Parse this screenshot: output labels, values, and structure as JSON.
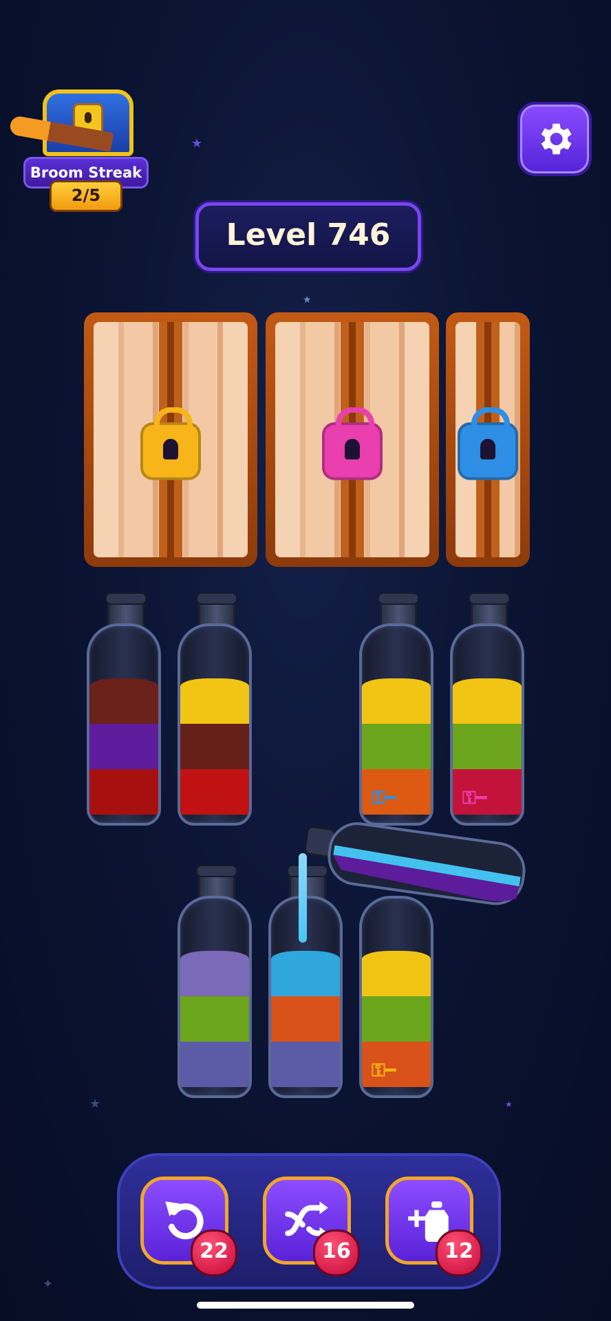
{
  "streak": {
    "label": "Broom Streak",
    "count": "2/5"
  },
  "level": {
    "title": "Level 746"
  },
  "crates": [
    {
      "lock_color": "#f7b51a",
      "lock_name": "yellow"
    },
    {
      "lock_color": "#ea3fae",
      "lock_name": "pink"
    },
    {
      "lock_color": "#2f8fe6",
      "lock_name": "blue"
    }
  ],
  "bottles": [
    {
      "layers": [
        "#a81010",
        "#5d1c9c",
        "#6b2019"
      ],
      "key": ""
    },
    {
      "layers": [
        "#c01212",
        "#672018",
        "#f2c414"
      ],
      "key": ""
    },
    {
      "layers": [
        "#dc5a12",
        "#6ba51c",
        "#f2c414"
      ],
      "key": "blue"
    },
    {
      "layers": [
        "#c4133a",
        "#6ba51c",
        "#f2c414"
      ],
      "key": "pink"
    },
    {
      "layers": [
        "#5a5aa6",
        "#6ba51c",
        "#7a6ab8"
      ],
      "key": ""
    },
    {
      "layers": [
        "#5a5aa6",
        "#d8521a",
        "#2fa6dc"
      ],
      "key": ""
    },
    {
      "layers": [
        "#d8521a",
        "#6ba51c",
        "#f2c414"
      ],
      "key": "orange"
    }
  ],
  "key_colors": {
    "blue": "#2f8fe6",
    "pink": "#ea3fae",
    "orange": "#f7b51a"
  },
  "toolbar": {
    "undo": {
      "count": "22",
      "icon": "undo-icon"
    },
    "shuffle": {
      "count": "16",
      "icon": "shuffle-icon"
    },
    "add_bottle": {
      "count": "12",
      "icon": "add-bottle-icon"
    }
  }
}
